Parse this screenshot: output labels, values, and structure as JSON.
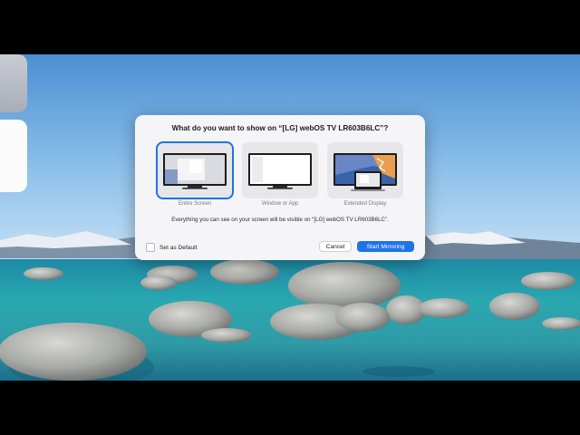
{
  "dialog": {
    "title": "What do you want to show on “[LG] webOS TV LR603B6LC”?",
    "options": [
      {
        "label": "Entire Screen",
        "selected": true
      },
      {
        "label": "Window or App",
        "selected": false
      },
      {
        "label": "Extended Display",
        "selected": false
      }
    ],
    "info": "Everything you can see on your screen will be visible on “[LG] webOS TV LR603B6LC”.",
    "set_default_label": "Set as Default",
    "set_default_checked": false,
    "cancel_label": "Cancel",
    "start_label": "Start Mirroring"
  },
  "colors": {
    "accent": "#1f73e8"
  }
}
